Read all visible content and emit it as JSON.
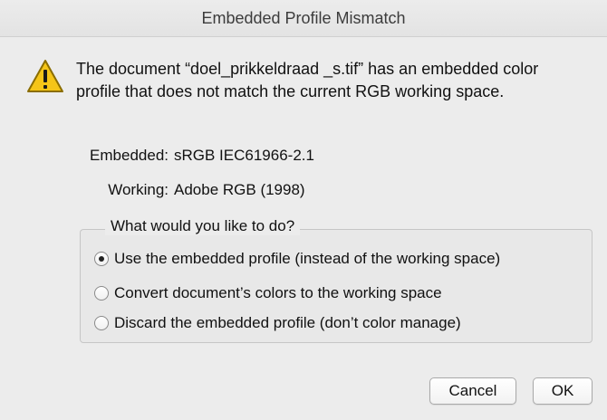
{
  "window": {
    "title": "Embedded Profile Mismatch"
  },
  "message": {
    "text": "The document “doel_prikkeldraad _s.tif” has an embedded color profile that does not match the current RGB working space.",
    "icon": "warning-icon"
  },
  "profiles": {
    "embedded_label": "Embedded:",
    "embedded_value": "sRGB IEC61966-2.1",
    "working_label": "Working:",
    "working_value": "Adobe RGB (1998)"
  },
  "options": {
    "legend": "What would you like to do?",
    "items": [
      {
        "label": "Use the embedded profile (instead of the working space)",
        "selected": true
      },
      {
        "label": "Convert document’s colors to the working space",
        "selected": false
      },
      {
        "label": "Discard the embedded profile (don’t color manage)",
        "selected": false
      }
    ]
  },
  "buttons": {
    "cancel_label": "Cancel",
    "ok_label": "OK"
  },
  "colors": {
    "warning_fill": "#f5c518",
    "warning_stroke": "#8a6d00"
  }
}
